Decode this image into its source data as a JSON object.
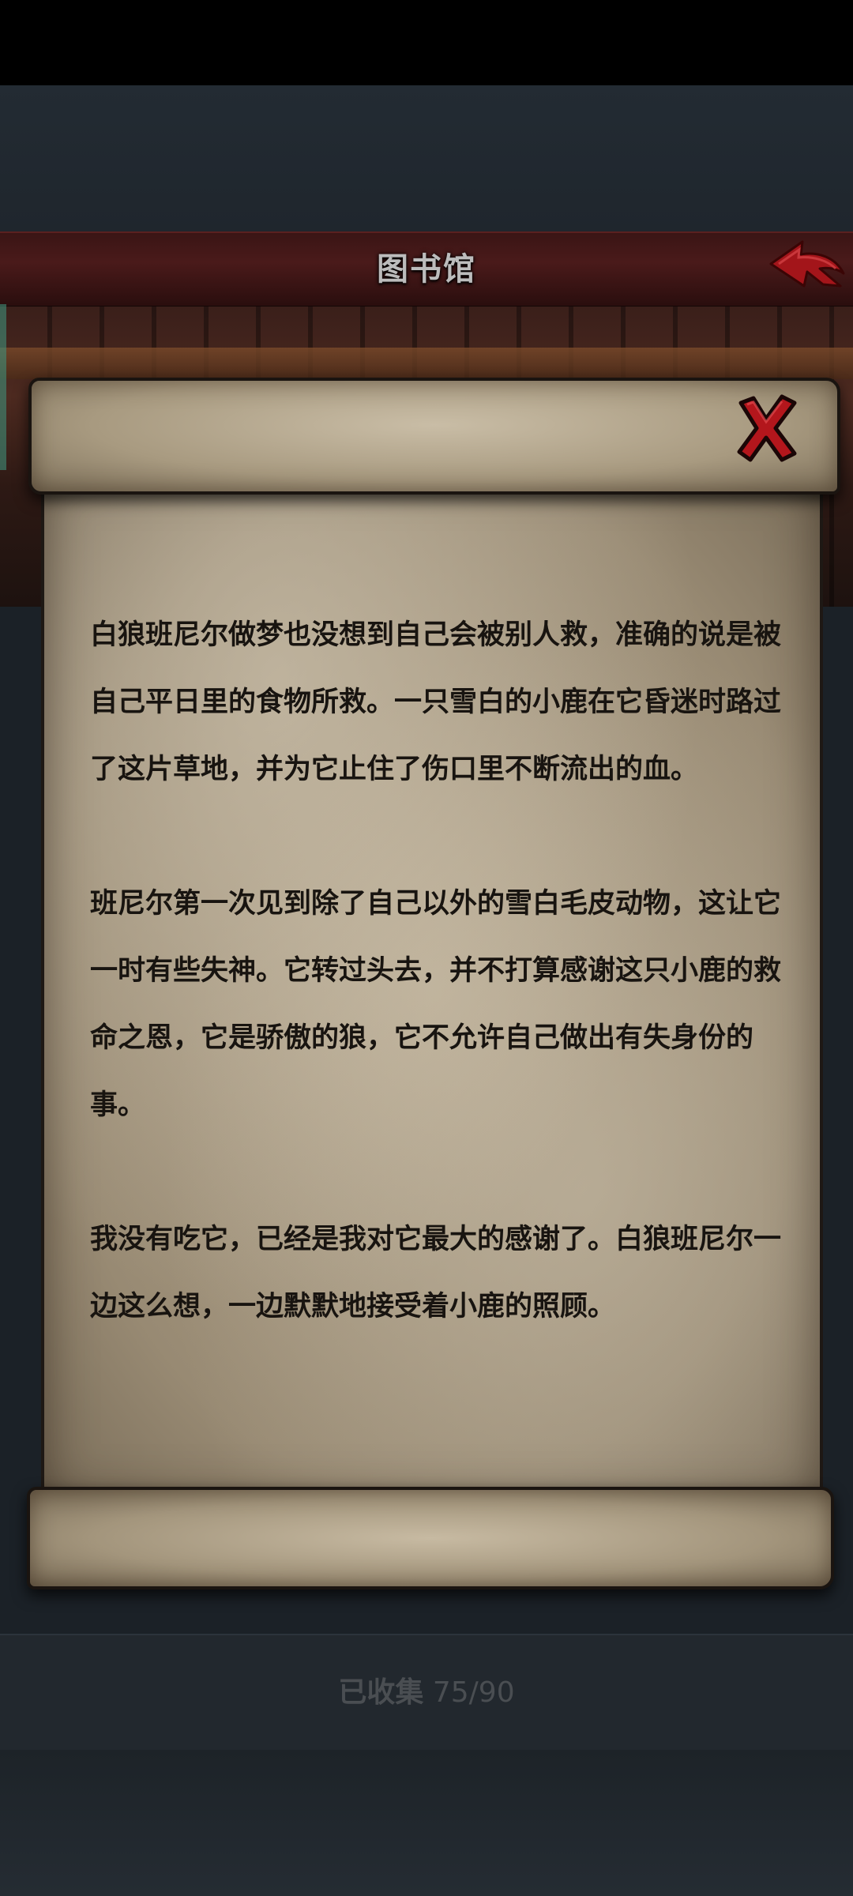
{
  "header": {
    "title": "图书馆"
  },
  "document": {
    "paragraphs": [
      "白狼班尼尔做梦也没想到自己会被别人救，准确的说是被自己平日里的食物所救。一只雪白的小鹿在它昏迷时路过了这片草地，并为它止住了伤口里不断流出的血。",
      "班尼尔第一次见到除了自己以外的雪白毛皮动物，这让它一时有些失神。它转过头去，并不打算感谢这只小鹿的救命之恩，它是骄傲的狼，它不允许自己做出有失身份的事。",
      "我没有吃它，已经是我对它最大的感谢了。白狼班尼尔一边这么想，一边默默地接受着小鹿的照顾。"
    ]
  },
  "footer": {
    "collected_label": "已收集",
    "collected_count": "75/90"
  },
  "colors": {
    "title_bar": "#4a1a1a",
    "back_arrow": "#a3151a",
    "close_x": "#b3161c",
    "paper": "#a99a82",
    "text": "#181410"
  },
  "icons": {
    "back": "back-arrow-icon",
    "close": "close-x-icon"
  }
}
